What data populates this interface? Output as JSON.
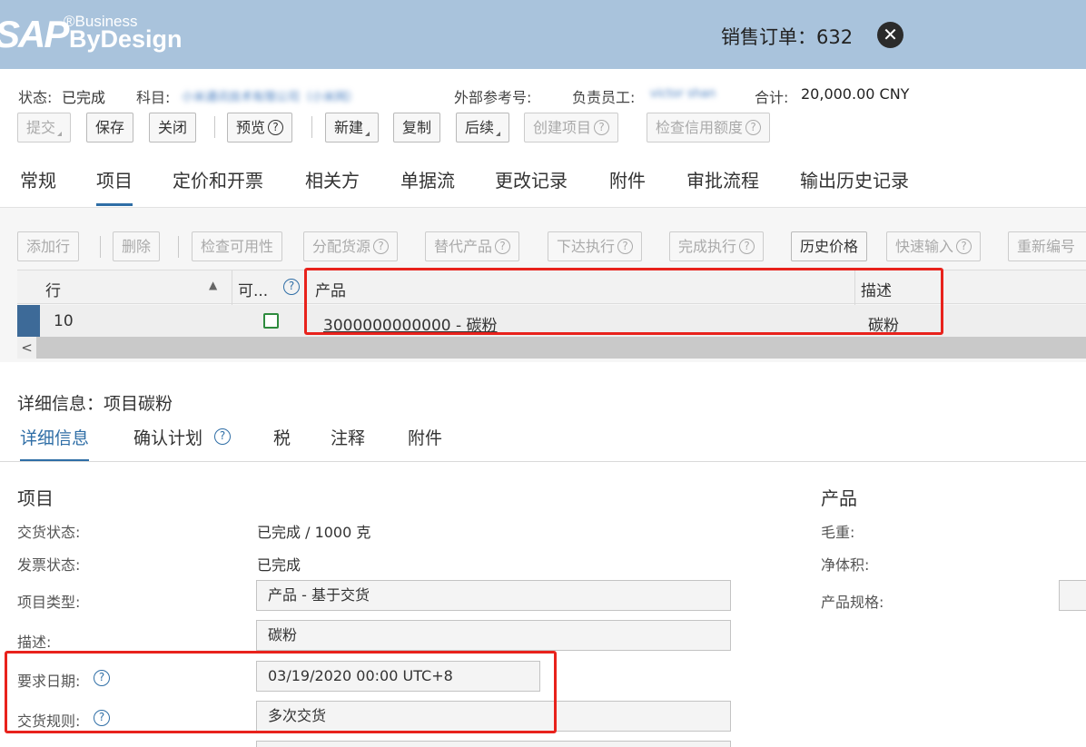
{
  "header": {
    "logo_sap": "SAP",
    "logo_business": "®Business",
    "logo_bydesign": "ByDesign",
    "title": "销售订单：632"
  },
  "info": {
    "status_label": "状态:",
    "status_value": "已完成",
    "account_label": "科目:",
    "account_value": "小米通讯技术有限公司（小米网）",
    "external_ref_label": "外部参考号:",
    "employee_label": "负责员工:",
    "employee_value": "victor shan",
    "total_label": "合计:",
    "total_value": "20,000.00 CNY"
  },
  "toolbar": {
    "submit": "提交",
    "save": "保存",
    "close": "关闭",
    "preview": "预览",
    "new": "新建",
    "copy": "复制",
    "follow_up": "后续",
    "create_project": "创建项目",
    "check_credit": "检查信用额度"
  },
  "tabs": [
    "常规",
    "项目",
    "定价和开票",
    "相关方",
    "单据流",
    "更改记录",
    "附件",
    "审批流程",
    "输出历史记录"
  ],
  "items_toolbar": {
    "add_row": "添加行",
    "delete": "删除",
    "check_availability": "检查可用性",
    "assign_source": "分配货源",
    "substitute_product": "替代产品",
    "release_execution": "下达执行",
    "finish_execution": "完成执行",
    "history_price": "历史价格",
    "quick_entry": "快速输入",
    "renumber": "重新编号"
  },
  "table": {
    "headers": {
      "row": "行",
      "available": "可...",
      "product": "产品",
      "description": "描述"
    },
    "rows": [
      {
        "row": "10",
        "product": "3000000000000 - 碳粉",
        "description": "碳粉"
      }
    ]
  },
  "detail": {
    "title": "详细信息：项目碳粉",
    "subtabs": [
      "详细信息",
      "确认计划",
      "税",
      "注释",
      "附件"
    ],
    "item_section": "项目",
    "product_section": "产品",
    "delivery_status_label": "交货状态:",
    "delivery_status_value": "已完成 / 1000 克",
    "invoice_status_label": "发票状态:",
    "invoice_status_value": "已完成",
    "item_type_label": "项目类型:",
    "item_type_value": "产品 - 基于交货",
    "description_label": "描述:",
    "description_value": "碳粉",
    "required_date_label": "要求日期:",
    "required_date_value": "03/19/2020 00:00 UTC+8",
    "delivery_rule_label": "交货规则:",
    "delivery_rule_value": "多次交货",
    "gross_weight_label": "毛重:",
    "net_volume_label": "净体积:",
    "product_spec_label": "产品规格:"
  },
  "colors": {
    "header_bg": "#a9c3dc",
    "accent": "#2f6ea6",
    "highlight_box": "#e8221c",
    "check_green": "#2e8b3e"
  }
}
